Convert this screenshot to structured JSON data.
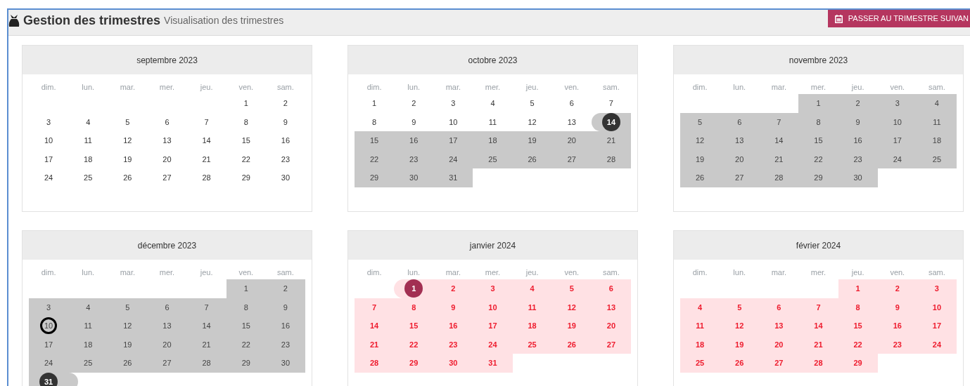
{
  "header": {
    "title": "Gestion des trimestres",
    "subtitle": "Visualisation des trimestres",
    "button": "PASSER AU TRIMESTRE SUIVAN"
  },
  "months": [
    {
      "title": "septembre 2023",
      "weekdays": [
        "dim.",
        "lun.",
        "mar.",
        "mer.",
        "jeu.",
        "ven.",
        "sam."
      ],
      "weeks": [
        [
          {
            "day": "1",
            "kind": "plain"
          },
          {
            "day": "2",
            "kind": "plain"
          }
        ],
        [
          {
            "day": "3",
            "kind": "plain"
          },
          {
            "day": "4",
            "kind": "plain"
          },
          {
            "day": "5",
            "kind": "plain"
          },
          {
            "day": "6",
            "kind": "plain"
          },
          {
            "day": "7",
            "kind": "plain"
          },
          {
            "day": "8",
            "kind": "plain"
          },
          {
            "day": "9",
            "kind": "plain"
          }
        ],
        [
          {
            "day": "10",
            "kind": "plain"
          },
          {
            "day": "11",
            "kind": "plain"
          },
          {
            "day": "12",
            "kind": "plain"
          },
          {
            "day": "13",
            "kind": "plain"
          },
          {
            "day": "14",
            "kind": "plain"
          },
          {
            "day": "15",
            "kind": "plain"
          },
          {
            "day": "16",
            "kind": "plain"
          }
        ],
        [
          {
            "day": "17",
            "kind": "plain"
          },
          {
            "day": "18",
            "kind": "plain"
          },
          {
            "day": "19",
            "kind": "plain"
          },
          {
            "day": "20",
            "kind": "plain"
          },
          {
            "day": "21",
            "kind": "plain"
          },
          {
            "day": "22",
            "kind": "plain"
          },
          {
            "day": "23",
            "kind": "plain"
          }
        ],
        [
          {
            "day": "24",
            "kind": "plain"
          },
          {
            "day": "25",
            "kind": "plain"
          },
          {
            "day": "26",
            "kind": "plain"
          },
          {
            "day": "27",
            "kind": "plain"
          },
          {
            "day": "28",
            "kind": "plain"
          },
          {
            "day": "29",
            "kind": "plain"
          },
          {
            "day": "30",
            "kind": "plain"
          }
        ]
      ]
    },
    {
      "title": "octobre 2023",
      "weekdays": [
        "dim.",
        "lun.",
        "mar.",
        "mer.",
        "jeu.",
        "ven.",
        "sam."
      ],
      "weeks": [
        [
          {
            "day": "1",
            "kind": "plain"
          },
          {
            "day": "2",
            "kind": "plain"
          },
          {
            "day": "3",
            "kind": "plain"
          },
          {
            "day": "4",
            "kind": "plain"
          },
          {
            "day": "5",
            "kind": "plain"
          },
          {
            "day": "6",
            "kind": "plain"
          },
          {
            "day": "7",
            "kind": "plain"
          }
        ],
        [
          {
            "day": "8",
            "kind": "plain"
          },
          {
            "day": "9",
            "kind": "plain"
          },
          {
            "day": "10",
            "kind": "plain"
          },
          {
            "day": "11",
            "kind": "plain"
          },
          {
            "day": "12",
            "kind": "plain"
          },
          {
            "day": "13",
            "kind": "plain"
          },
          {
            "day": "14",
            "kind": "currentstart"
          }
        ],
        [
          {
            "day": "15",
            "kind": "current"
          },
          {
            "day": "16",
            "kind": "current"
          },
          {
            "day": "17",
            "kind": "current"
          },
          {
            "day": "18",
            "kind": "current"
          },
          {
            "day": "19",
            "kind": "current"
          },
          {
            "day": "20",
            "kind": "current"
          },
          {
            "day": "21",
            "kind": "current"
          }
        ],
        [
          {
            "day": "22",
            "kind": "current"
          },
          {
            "day": "23",
            "kind": "current"
          },
          {
            "day": "24",
            "kind": "current"
          },
          {
            "day": "25",
            "kind": "current"
          },
          {
            "day": "26",
            "kind": "current"
          },
          {
            "day": "27",
            "kind": "current"
          },
          {
            "day": "28",
            "kind": "current"
          }
        ],
        [
          {
            "day": "29",
            "kind": "current"
          },
          {
            "day": "30",
            "kind": "current"
          },
          {
            "day": "31",
            "kind": "current"
          }
        ]
      ]
    },
    {
      "title": "novembre 2023",
      "weekdays": [
        "dim.",
        "lun.",
        "mar.",
        "mer.",
        "jeu.",
        "ven.",
        "sam."
      ],
      "weeks": [
        [
          {
            "day": "1",
            "kind": "current"
          },
          {
            "day": "2",
            "kind": "current"
          },
          {
            "day": "3",
            "kind": "current"
          },
          {
            "day": "4",
            "kind": "current"
          }
        ],
        [
          {
            "day": "5",
            "kind": "current"
          },
          {
            "day": "6",
            "kind": "current"
          },
          {
            "day": "7",
            "kind": "current"
          },
          {
            "day": "8",
            "kind": "current"
          },
          {
            "day": "9",
            "kind": "current"
          },
          {
            "day": "10",
            "kind": "current"
          },
          {
            "day": "11",
            "kind": "current"
          }
        ],
        [
          {
            "day": "12",
            "kind": "current"
          },
          {
            "day": "13",
            "kind": "current"
          },
          {
            "day": "14",
            "kind": "current"
          },
          {
            "day": "15",
            "kind": "current"
          },
          {
            "day": "16",
            "kind": "current"
          },
          {
            "day": "17",
            "kind": "current"
          },
          {
            "day": "18",
            "kind": "current"
          }
        ],
        [
          {
            "day": "19",
            "kind": "current"
          },
          {
            "day": "20",
            "kind": "current"
          },
          {
            "day": "21",
            "kind": "current"
          },
          {
            "day": "22",
            "kind": "current"
          },
          {
            "day": "23",
            "kind": "current"
          },
          {
            "day": "24",
            "kind": "current"
          },
          {
            "day": "25",
            "kind": "current"
          }
        ],
        [
          {
            "day": "26",
            "kind": "current"
          },
          {
            "day": "27",
            "kind": "current"
          },
          {
            "day": "28",
            "kind": "current"
          },
          {
            "day": "29",
            "kind": "current"
          },
          {
            "day": "30",
            "kind": "current"
          }
        ]
      ]
    },
    {
      "title": "décembre 2023",
      "weekdays": [
        "dim.",
        "lun.",
        "mar.",
        "mer.",
        "jeu.",
        "ven.",
        "sam."
      ],
      "weeks": [
        [
          {
            "day": "1",
            "kind": "current"
          },
          {
            "day": "2",
            "kind": "current"
          }
        ],
        [
          {
            "day": "3",
            "kind": "current"
          },
          {
            "day": "4",
            "kind": "current"
          },
          {
            "day": "5",
            "kind": "current"
          },
          {
            "day": "6",
            "kind": "current"
          },
          {
            "day": "7",
            "kind": "current"
          },
          {
            "day": "8",
            "kind": "current"
          },
          {
            "day": "9",
            "kind": "current"
          }
        ],
        [
          {
            "day": "10",
            "kind": "currenttoday"
          },
          {
            "day": "11",
            "kind": "current"
          },
          {
            "day": "12",
            "kind": "current"
          },
          {
            "day": "13",
            "kind": "current"
          },
          {
            "day": "14",
            "kind": "current"
          },
          {
            "day": "15",
            "kind": "current"
          },
          {
            "day": "16",
            "kind": "current"
          }
        ],
        [
          {
            "day": "17",
            "kind": "current"
          },
          {
            "day": "18",
            "kind": "current"
          },
          {
            "day": "19",
            "kind": "current"
          },
          {
            "day": "20",
            "kind": "current"
          },
          {
            "day": "21",
            "kind": "current"
          },
          {
            "day": "22",
            "kind": "current"
          },
          {
            "day": "23",
            "kind": "current"
          }
        ],
        [
          {
            "day": "24",
            "kind": "current"
          },
          {
            "day": "25",
            "kind": "current"
          },
          {
            "day": "26",
            "kind": "current"
          },
          {
            "day": "27",
            "kind": "current"
          },
          {
            "day": "28",
            "kind": "current"
          },
          {
            "day": "29",
            "kind": "current"
          },
          {
            "day": "30",
            "kind": "current"
          }
        ],
        [
          {
            "day": "31",
            "kind": "currentend"
          }
        ]
      ]
    },
    {
      "title": "janvier 2024",
      "weekdays": [
        "dim.",
        "lun.",
        "mar.",
        "mer.",
        "jeu.",
        "ven.",
        "sam."
      ],
      "weeks": [
        [
          {
            "day": "1",
            "kind": "nextstart"
          },
          {
            "day": "2",
            "kind": "next"
          },
          {
            "day": "3",
            "kind": "next"
          },
          {
            "day": "4",
            "kind": "next"
          },
          {
            "day": "5",
            "kind": "next"
          },
          {
            "day": "6",
            "kind": "next"
          }
        ],
        [
          {
            "day": "7",
            "kind": "next"
          },
          {
            "day": "8",
            "kind": "next"
          },
          {
            "day": "9",
            "kind": "next"
          },
          {
            "day": "10",
            "kind": "next"
          },
          {
            "day": "11",
            "kind": "next"
          },
          {
            "day": "12",
            "kind": "next"
          },
          {
            "day": "13",
            "kind": "next"
          }
        ],
        [
          {
            "day": "14",
            "kind": "next"
          },
          {
            "day": "15",
            "kind": "next"
          },
          {
            "day": "16",
            "kind": "next"
          },
          {
            "day": "17",
            "kind": "next"
          },
          {
            "day": "18",
            "kind": "next"
          },
          {
            "day": "19",
            "kind": "next"
          },
          {
            "day": "20",
            "kind": "next"
          }
        ],
        [
          {
            "day": "21",
            "kind": "next"
          },
          {
            "day": "22",
            "kind": "next"
          },
          {
            "day": "23",
            "kind": "next"
          },
          {
            "day": "24",
            "kind": "next"
          },
          {
            "day": "25",
            "kind": "next"
          },
          {
            "day": "26",
            "kind": "next"
          },
          {
            "day": "27",
            "kind": "next"
          }
        ],
        [
          {
            "day": "28",
            "kind": "next"
          },
          {
            "day": "29",
            "kind": "next"
          },
          {
            "day": "30",
            "kind": "next"
          },
          {
            "day": "31",
            "kind": "next"
          }
        ]
      ]
    },
    {
      "title": "février 2024",
      "weekdays": [
        "dim.",
        "lun.",
        "mar.",
        "mer.",
        "jeu.",
        "ven.",
        "sam."
      ],
      "weeks": [
        [
          {
            "day": "1",
            "kind": "next"
          },
          {
            "day": "2",
            "kind": "next"
          },
          {
            "day": "3",
            "kind": "next"
          }
        ],
        [
          {
            "day": "4",
            "kind": "next"
          },
          {
            "day": "5",
            "kind": "next"
          },
          {
            "day": "6",
            "kind": "next"
          },
          {
            "day": "7",
            "kind": "next"
          },
          {
            "day": "8",
            "kind": "next"
          },
          {
            "day": "9",
            "kind": "next"
          },
          {
            "day": "10",
            "kind": "next"
          }
        ],
        [
          {
            "day": "11",
            "kind": "next"
          },
          {
            "day": "12",
            "kind": "next"
          },
          {
            "day": "13",
            "kind": "next"
          },
          {
            "day": "14",
            "kind": "next"
          },
          {
            "day": "15",
            "kind": "next"
          },
          {
            "day": "16",
            "kind": "next"
          },
          {
            "day": "17",
            "kind": "next"
          }
        ],
        [
          {
            "day": "18",
            "kind": "next"
          },
          {
            "day": "19",
            "kind": "next"
          },
          {
            "day": "20",
            "kind": "next"
          },
          {
            "day": "21",
            "kind": "next"
          },
          {
            "day": "22",
            "kind": "next"
          },
          {
            "day": "23",
            "kind": "next"
          },
          {
            "day": "24",
            "kind": "next"
          }
        ],
        [
          {
            "day": "25",
            "kind": "next"
          },
          {
            "day": "26",
            "kind": "next"
          },
          {
            "day": "27",
            "kind": "next"
          },
          {
            "day": "28",
            "kind": "next"
          },
          {
            "day": "29",
            "kind": "next"
          }
        ]
      ]
    }
  ]
}
